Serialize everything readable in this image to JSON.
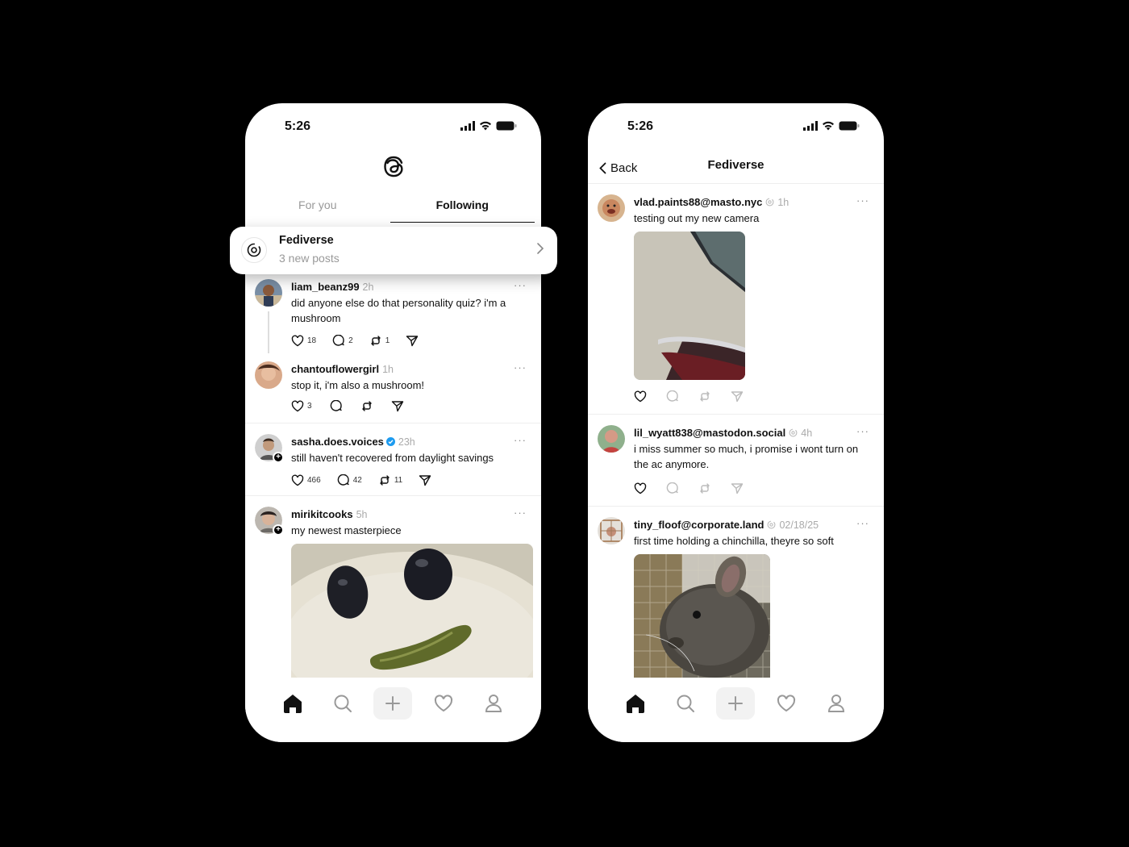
{
  "left": {
    "time": "5:26",
    "tabs": [
      {
        "label": "For you"
      },
      {
        "label": "Following"
      }
    ],
    "fediverse_card": {
      "title": "Fediverse",
      "subtitle": "3 new posts"
    },
    "posts": [
      {
        "user": "liam_beanz99",
        "age": "2h",
        "text": "did anyone else do that personality quiz? i'm a mushroom",
        "likes": "18",
        "replies": "2",
        "reposts": "1"
      },
      {
        "user": "chantouflowergirl",
        "age": "1h",
        "text": "stop it, i'm also a mushroom!",
        "likes": "3",
        "replies": "",
        "reposts": ""
      },
      {
        "user": "sasha.does.voices",
        "age": "23h",
        "text": "still haven't recovered from daylight savings",
        "likes": "466",
        "replies": "42",
        "reposts": "11"
      },
      {
        "user": "mirikitcooks",
        "age": "5h",
        "text": "my newest masterpiece"
      }
    ]
  },
  "right": {
    "time": "5:26",
    "back_label": "Back",
    "title": "Fediverse",
    "posts": [
      {
        "user": "vlad.paints88@masto.nyc",
        "age": "1h",
        "text": "testing out my new camera"
      },
      {
        "user": "lil_wyatt838@mastodon.social",
        "age": "4h",
        "text": "i miss summer so much, i promise i wont turn on the ac anymore."
      },
      {
        "user": "tiny_floof@corporate.land",
        "age": "02/18/25",
        "text": "first time holding a chinchilla, theyre so soft"
      }
    ]
  },
  "icons": {
    "logo": "threads-logo-icon",
    "fediverse": "fediverse-icon",
    "like": "heart-icon",
    "reply": "comment-icon",
    "repost": "repost-icon",
    "share": "send-icon",
    "more": "more-icon",
    "nav": [
      "home-icon",
      "search-icon",
      "plus-icon",
      "heart-icon",
      "profile-icon"
    ]
  },
  "colors": {
    "verified": "#1d9bf0",
    "background": "#000000"
  }
}
